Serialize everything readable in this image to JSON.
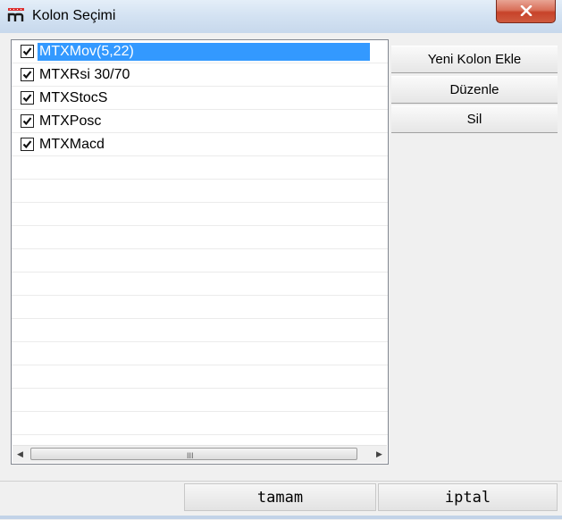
{
  "window": {
    "title": "Kolon Seçimi",
    "app_icon": "app-logo-icon",
    "close_icon": "close-icon"
  },
  "columns_list": {
    "items": [
      {
        "label": "MTXMov(5,22)",
        "checked": true,
        "selected": true
      },
      {
        "label": "MTXRsi 30/70",
        "checked": true,
        "selected": false
      },
      {
        "label": "MTXStocS",
        "checked": true,
        "selected": false
      },
      {
        "label": "MTXPosc",
        "checked": true,
        "selected": false
      },
      {
        "label": "MTXMacd",
        "checked": true,
        "selected": false
      }
    ],
    "scrollbar_grip": "III"
  },
  "side_buttons": {
    "add_label": "Yeni Kolon Ekle",
    "edit_label": "Düzenle",
    "delete_label": "Sil"
  },
  "footer": {
    "ok_label": "tamam",
    "cancel_label": "iptal"
  },
  "colors": {
    "selection": "#3399ff",
    "close_button": "#c7432a"
  }
}
